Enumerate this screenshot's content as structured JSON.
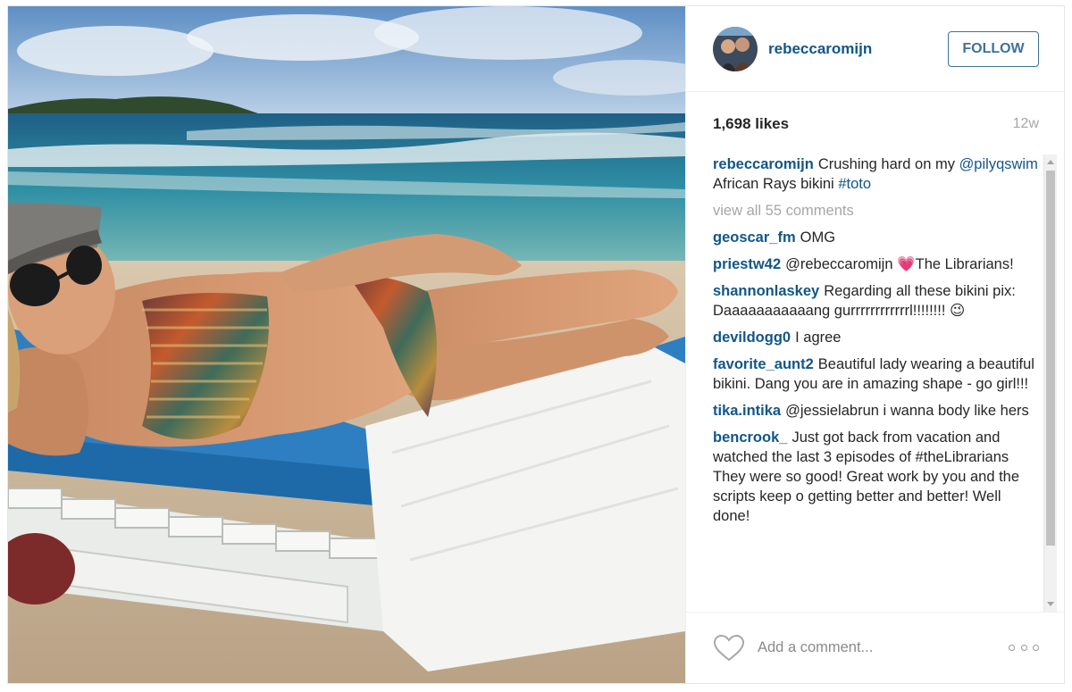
{
  "post": {
    "username": "rebeccaromijn",
    "follow_label": "FOLLOW",
    "likes": "1,698 likes",
    "time_ago": "12w",
    "caption": {
      "user": "rebeccaromijn",
      "text_before": "Crushing hard on my ",
      "mention": "@pilyqswim",
      "text_middle": " African Rays bikini ",
      "hashtag": "#toto"
    },
    "view_all_comments": "view all 55 comments",
    "comments": [
      {
        "user": "geoscar_fm",
        "text": "OMG"
      },
      {
        "user": "priestw42",
        "text": "@rebeccaromijn 💗The Librarians!"
      },
      {
        "user": "shannonlaskey",
        "text": "Regarding all these bikini pix: Daaaaaaaaaaang gurrrrrrrrrrrrl!!!!!!!! 😉"
      },
      {
        "user": "devildogg0",
        "text": "I agree"
      },
      {
        "user": "favorite_aunt2",
        "text": "Beautiful lady wearing a beautiful bikini. Dang you are in amazing shape - go girl!!!"
      },
      {
        "user": "tika.intika",
        "text": "@jessielabrun i wanna body like hers"
      },
      {
        "user": "bencrook_",
        "text": "Just got back from vacation and watched the last 3 episodes of #theLibrarians They were so good! Great work by you and the scripts keep o getting better and better! Well done!"
      }
    ],
    "add_comment_placeholder": "Add a comment...",
    "icons": {
      "like": "heart-icon",
      "more": "more-options-icon"
    },
    "colors": {
      "link": "#125688",
      "follow": "#3f729b",
      "muted": "#a5a7aa"
    }
  }
}
